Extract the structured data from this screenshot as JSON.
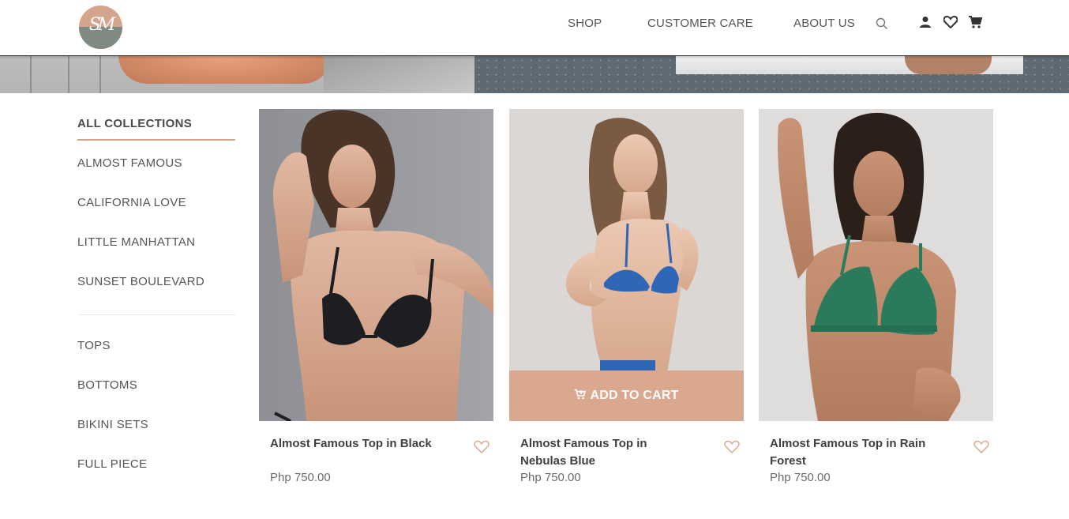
{
  "header": {
    "logo_monogram": "SM",
    "nav": {
      "shop": "SHOP",
      "customer_care": "CUSTOMER CARE",
      "about_us": "ABOUT US"
    },
    "icons": [
      "search-icon",
      "user-icon",
      "heart-icon",
      "cart-icon"
    ]
  },
  "sidebar": {
    "title": "ALL COLLECTIONS",
    "collections": [
      "ALMOST FAMOUS",
      "CALIFORNIA LOVE",
      "LITTLE MANHATTAN",
      "SUNSET BOULEVARD"
    ],
    "categories": [
      "TOPS",
      "BOTTOMS",
      "BIKINI SETS",
      "FULL PIECE"
    ]
  },
  "products": [
    {
      "title": "Almost Famous Top in Black",
      "price": "Php 750.00",
      "swimwear_color": "#1c1e22"
    },
    {
      "title": "Almost Famous Top in Nebulas Blue",
      "price": "Php 750.00",
      "swimwear_color": "#2f66b5"
    },
    {
      "title": "Almost Famous Top in Rain Forest",
      "price": "Php 750.00",
      "swimwear_color": "#2a7a5c"
    }
  ],
  "add_to_cart_label": "ADD TO CART",
  "colors": {
    "accent": "#d9a88e",
    "text": "#4a4a4a"
  }
}
